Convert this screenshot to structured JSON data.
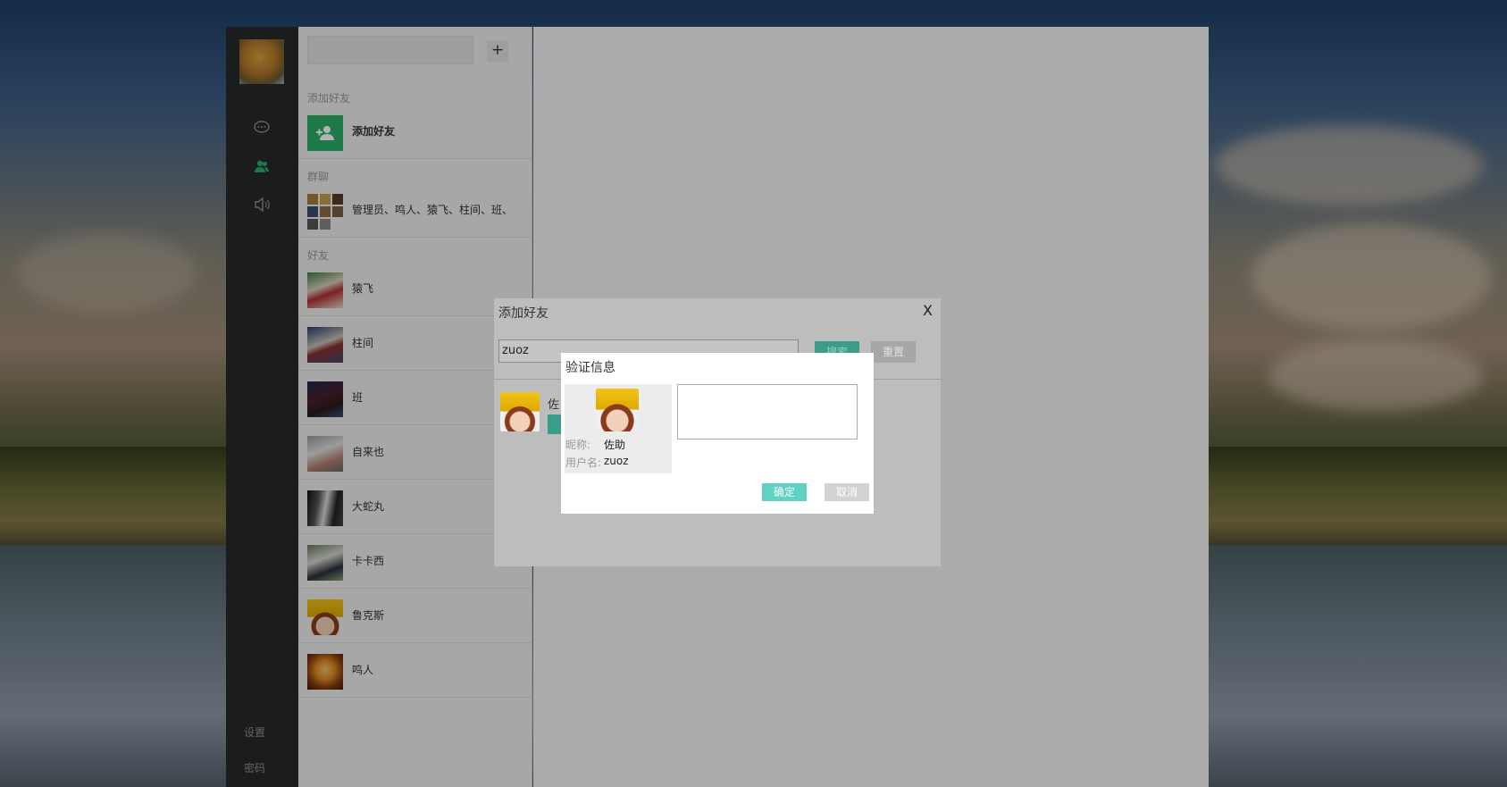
{
  "nav": {
    "settings_label": "设置",
    "password_label": "密码",
    "icons": [
      "chat-icon",
      "contacts-icon",
      "speaker-icon"
    ]
  },
  "list": {
    "add_button": "+",
    "sections": {
      "add_friend": "添加好友",
      "group_chat": "群聊",
      "friends": "好友"
    },
    "add_friend_item": "添加好友",
    "group_item": "管理员、鸣人、猿飞、柱间、班、",
    "friends": [
      {
        "name": "猿飞"
      },
      {
        "name": "柱间"
      },
      {
        "name": "班"
      },
      {
        "name": "自来也"
      },
      {
        "name": "大蛇丸"
      },
      {
        "name": "卡卡西"
      },
      {
        "name": "鲁克斯"
      },
      {
        "name": "鸣人"
      }
    ]
  },
  "add_friend_dialog": {
    "title": "添加好友",
    "close": "X",
    "search_value": "zuoz",
    "search_button": "搜索",
    "reset_button": "重置",
    "result_name": "佐"
  },
  "verify_dialog": {
    "title": "验证信息",
    "nickname_label": "昵称:",
    "nickname": "佐助",
    "username_label": "用户名:",
    "username": "zuoz",
    "message": "",
    "confirm": "确定",
    "cancel": "取消"
  },
  "colors": {
    "accent_green": "#2aae67",
    "confirm_teal": "#5fd3c3",
    "nav_bg": "#28292c"
  }
}
